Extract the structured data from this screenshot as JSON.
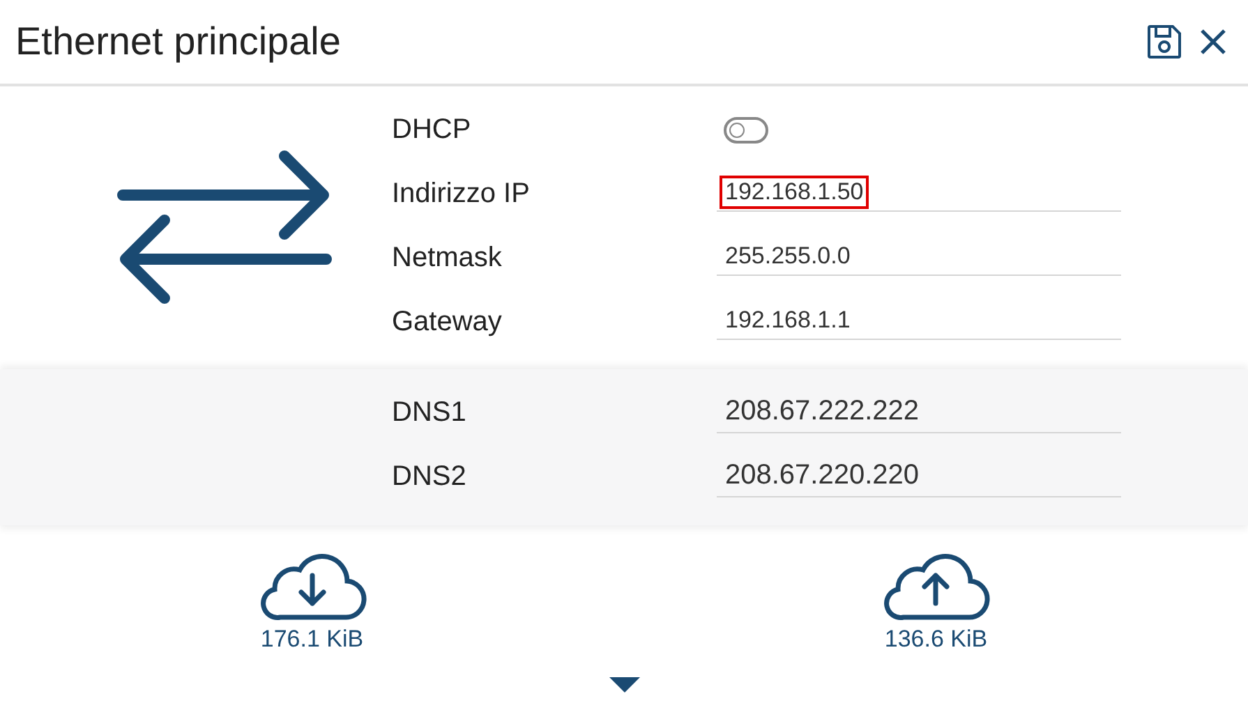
{
  "title": "Ethernet principale",
  "dhcp": {
    "label": "DHCP",
    "on": false
  },
  "fields": [
    {
      "label": "Indirizzo IP",
      "value": "192.168.1.50",
      "highlighted": true
    },
    {
      "label": "Netmask",
      "value": "255.255.0.0",
      "highlighted": false
    },
    {
      "label": "Gateway",
      "value": "192.168.1.1",
      "highlighted": false
    }
  ],
  "dns": [
    {
      "label": "DNS1",
      "value": "208.67.222.222"
    },
    {
      "label": "DNS2",
      "value": "208.67.220.220"
    }
  ],
  "traffic": [
    {
      "kind": "download",
      "amount": "176.1 KiB"
    },
    {
      "kind": "upload",
      "amount": "136.6 KiB"
    }
  ]
}
